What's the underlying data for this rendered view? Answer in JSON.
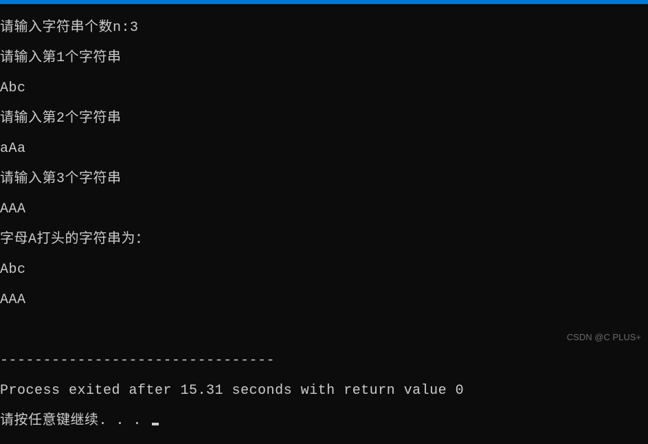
{
  "terminal": {
    "lines": [
      "请输入字符串个数n:3",
      "请输入第1个字符串",
      "Abc",
      "请输入第2个字符串",
      "aAa",
      "请输入第3个字符串",
      "AAA",
      "字母A打头的字符串为：",
      "Abc",
      "AAA"
    ],
    "separator": "--------------------------------",
    "process_exit": "Process exited after 15.31 seconds with return value 0",
    "continue_prompt": "请按任意键继续. . . "
  },
  "watermark": "CSDN @C PLUS+"
}
